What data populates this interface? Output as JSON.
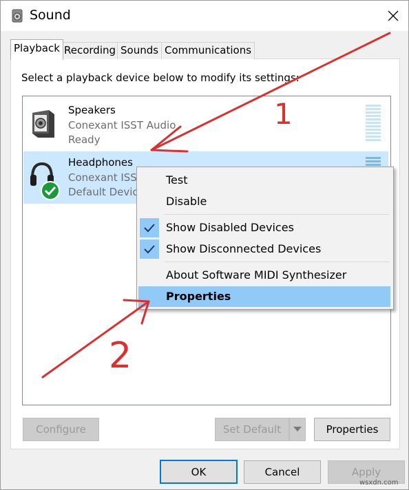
{
  "window": {
    "title": "Sound",
    "close_glyph": "✕"
  },
  "tabs": [
    {
      "label": "Playback",
      "active": true
    },
    {
      "label": "Recording",
      "active": false
    },
    {
      "label": "Sounds",
      "active": false
    },
    {
      "label": "Communications",
      "active": false
    }
  ],
  "instructions": "Select a playback device below to modify its settings:",
  "devices": [
    {
      "name": "Speakers",
      "driver": "Conexant ISST Audio",
      "status": "Ready",
      "icon": "speaker-icon",
      "selected": false
    },
    {
      "name": "Headphones",
      "driver": "Conexant ISST Audio",
      "status": "Default Device",
      "icon": "headphones-icon",
      "selected": true
    }
  ],
  "context_menu": {
    "items": [
      {
        "label": "Test",
        "checked": false,
        "highlighted": false
      },
      {
        "label": "Disable",
        "checked": false,
        "highlighted": false
      },
      {
        "label": "Show Disabled Devices",
        "checked": true,
        "highlighted": false
      },
      {
        "label": "Show Disconnected Devices",
        "checked": true,
        "highlighted": false
      },
      {
        "label": "About Software MIDI Synthesizer",
        "checked": false,
        "highlighted": false
      },
      {
        "label": "Properties",
        "checked": false,
        "highlighted": true
      }
    ]
  },
  "panel_buttons": {
    "configure": "Configure",
    "set_default": "Set Default",
    "properties": "Properties"
  },
  "dialog_buttons": {
    "ok": "OK",
    "cancel": "Cancel",
    "apply": "Apply"
  },
  "annotations": {
    "label_1": "1",
    "label_2": "2",
    "color": "#d93030"
  },
  "colors": {
    "selection": "#cce8ff",
    "menu_highlight": "#91c9f7",
    "accent": "#0078d7"
  },
  "watermark": "wsxdn.com"
}
